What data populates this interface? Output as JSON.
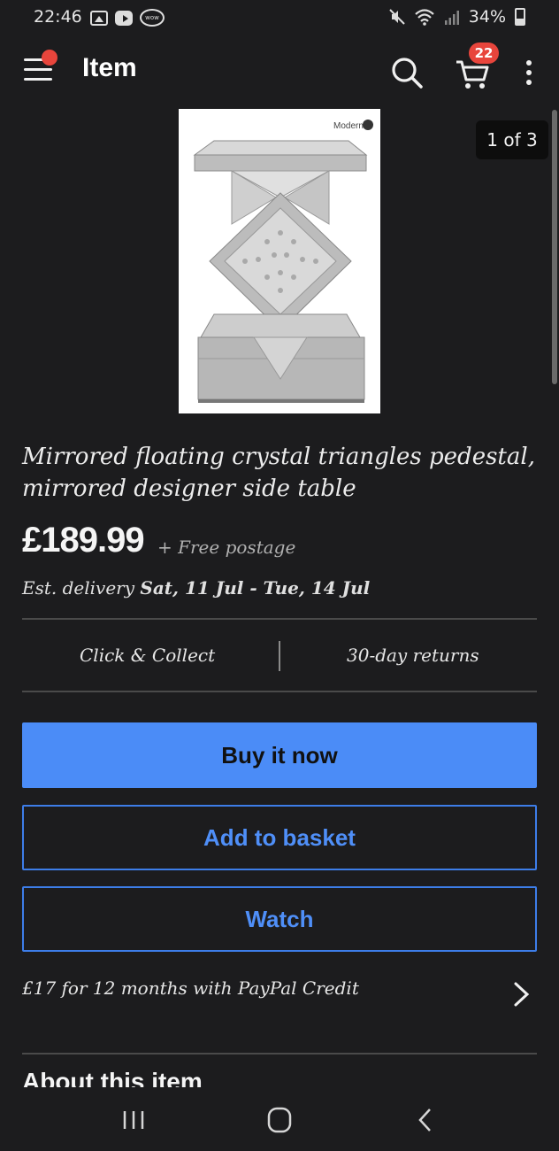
{
  "status_bar": {
    "time": "22:46",
    "battery": "34%",
    "icons": [
      "gallery-icon",
      "youtube-icon",
      "wow-icon",
      "mute-icon",
      "wifi-icon",
      "signal-icon",
      "battery-icon"
    ]
  },
  "app_bar": {
    "title": "Item",
    "cart_count": "22"
  },
  "gallery": {
    "counter": "1 of 3",
    "logo_text": "Modern"
  },
  "product": {
    "title": "Mirrored floating crystal triangles pedestal, mirrored designer side table",
    "price": "£189.99",
    "postage": "+ Free postage",
    "delivery_prefix": "Est. delivery ",
    "delivery_dates": "Sat, 11 Jul - Tue, 14 Jul"
  },
  "features": {
    "left": "Click & Collect",
    "right": "30-day returns"
  },
  "buttons": {
    "buy": "Buy it now",
    "basket": "Add to basket",
    "watch": "Watch"
  },
  "credit": {
    "text": "£17 for 12 months with PayPal Credit"
  },
  "about": {
    "heading": "About this item"
  },
  "colors": {
    "background": "#1c1c1e",
    "accent_blue": "#4b8cf7",
    "badge_red": "#e8453c"
  }
}
